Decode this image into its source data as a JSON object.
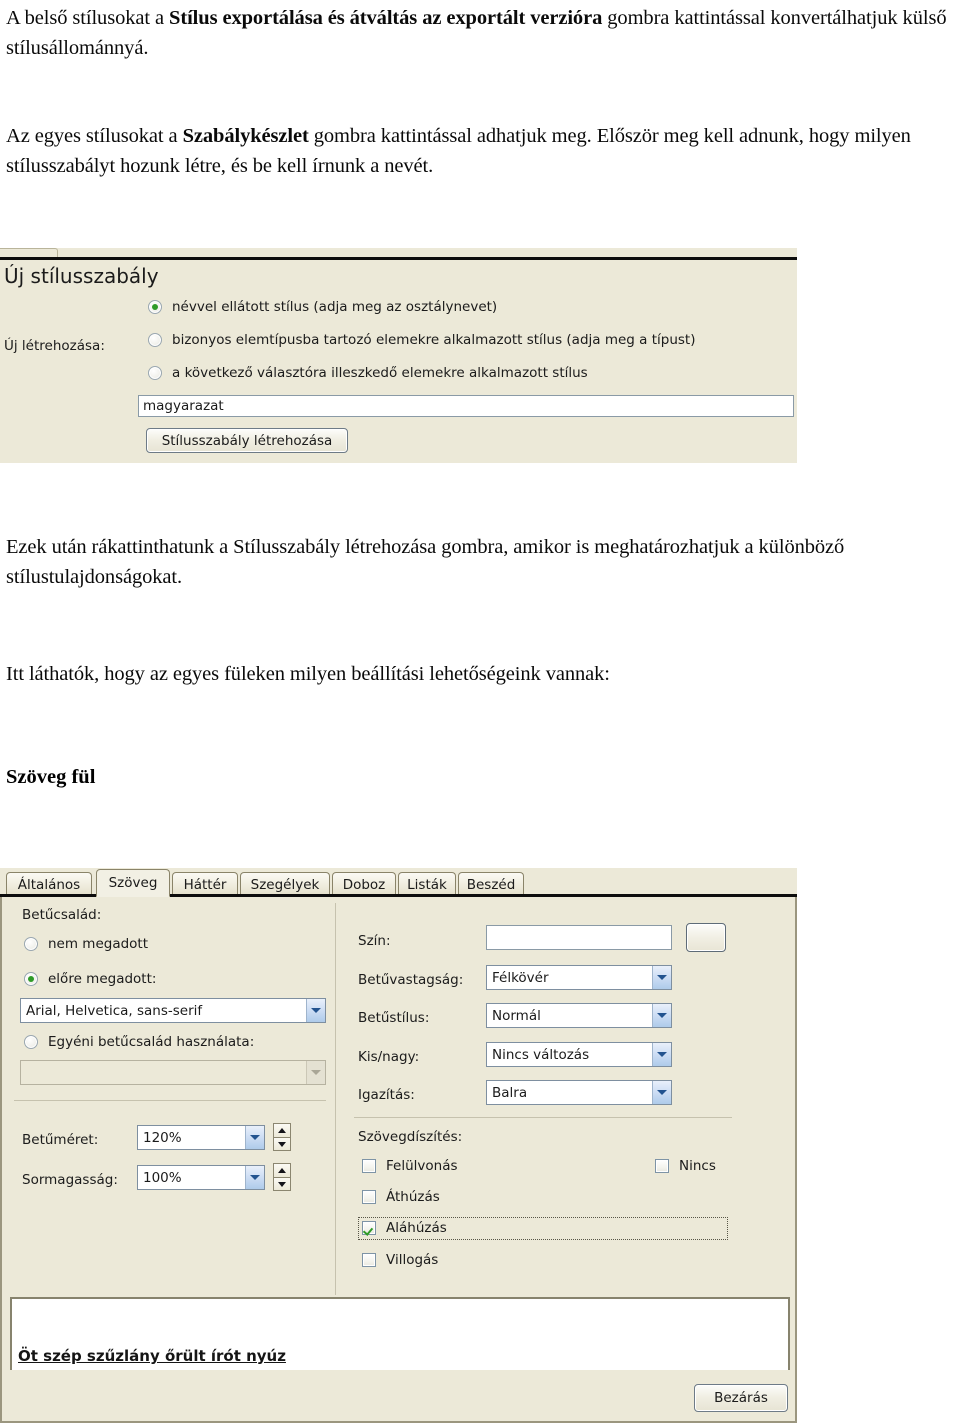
{
  "document": {
    "paragraph_1_pre": "A belső stílusokat a ",
    "paragraph_1_bold": "Stílus exportálása és átváltás az exportált verzióra",
    "paragraph_1_post": " gombra kattintással konvertálhatjuk külső stílusállománnyá.",
    "paragraph_2_pre": "Az egyes stílusokat a ",
    "paragraph_2_bold": "Szabálykészlet",
    "paragraph_2_post": " gombra kattintással adhatjuk meg. Először meg kell adnunk, hogy milyen stílusszabályt hozunk létre, és be kell írnunk a nevét.",
    "paragraph_3": "Ezek után rákattinthatunk a Stílusszabály létrehozása gombra, amikor is meghatározhatjuk a különböző stílustulajdonságokat.",
    "paragraph_4": "Itt láthatók, hogy az egyes füleken milyen beállítási lehetőségeink vannak:",
    "heading_szoveg": "Szöveg fül"
  },
  "new_rule_dialog": {
    "title": "Új stílusszabály",
    "create_label": "Új létrehozása:",
    "options": [
      {
        "label": "névvel ellátott stílus (adja meg az osztálynevet)",
        "selected": true
      },
      {
        "label": "bizonyos elemtípusba tartozó elemekre alkalmazott stílus (adja meg a típust)",
        "selected": false
      },
      {
        "label": "a következő választóra illeszkedő elemekre alkalmazott stílus",
        "selected": false
      }
    ],
    "name_input": {
      "value": "magyarazat",
      "placeholder": ""
    },
    "create_button": "Stílusszabály létrehozása"
  },
  "text_tab_dialog": {
    "tabs": [
      {
        "label": "Általános",
        "active": false
      },
      {
        "label": "Szöveg",
        "active": true
      },
      {
        "label": "Háttér",
        "active": false
      },
      {
        "label": "Szegélyek",
        "active": false
      },
      {
        "label": "Doboz",
        "active": false
      },
      {
        "label": "Listák",
        "active": false
      },
      {
        "label": "Beszéd",
        "active": false
      }
    ],
    "left": {
      "font_family_label": "Betűcsalád:",
      "radio_unset": {
        "label": "nem megadott",
        "selected": false
      },
      "radio_preset": {
        "label": "előre megadott:",
        "selected": true
      },
      "preset_combo": {
        "value": "Arial, Helvetica, sans-serif"
      },
      "radio_custom": {
        "label": "Egyéni betűcsalád használata:",
        "selected": false
      },
      "custom_combo": {
        "value": "",
        "disabled": true
      },
      "font_size_label": "Betűméret:",
      "font_size_value": "120%",
      "line_height_label": "Sormagasság:",
      "line_height_value": "100%"
    },
    "right": {
      "color_label": "Szín:",
      "color_value": "",
      "weight_label": "Betűvastagság:",
      "weight_value": "Félkövér",
      "style_label": "Betűstílus:",
      "style_value": "Normál",
      "case_label": "Kis/nagy:",
      "case_value": "Nincs változás",
      "align_label": "Igazítás:",
      "align_value": "Balra",
      "decoration_label": "Szövegdíszítés:",
      "decorations": [
        {
          "label": "Felülvonás",
          "checked": false
        },
        {
          "label": "Áthúzás",
          "checked": false
        },
        {
          "label": "Aláhúzás",
          "checked": true,
          "focused": true
        },
        {
          "label": "Villogás",
          "checked": false
        }
      ],
      "decoration_none": {
        "label": "Nincs",
        "checked": false
      }
    },
    "preview_text": "Öt szép szűzlány őrült írót nyúz",
    "close_button": "Bezárás"
  },
  "colors": {
    "dialog_bg": "#ECE9D8",
    "accent_selected": "#2f9b28",
    "combo_arrow": "#22538f",
    "page_bg": "#ffffff"
  },
  "icons": {
    "chevron_down": "chevron-down-icon",
    "spinner_up": "triangle-up-icon",
    "spinner_down": "triangle-down-icon",
    "checkmark": "check-icon"
  }
}
